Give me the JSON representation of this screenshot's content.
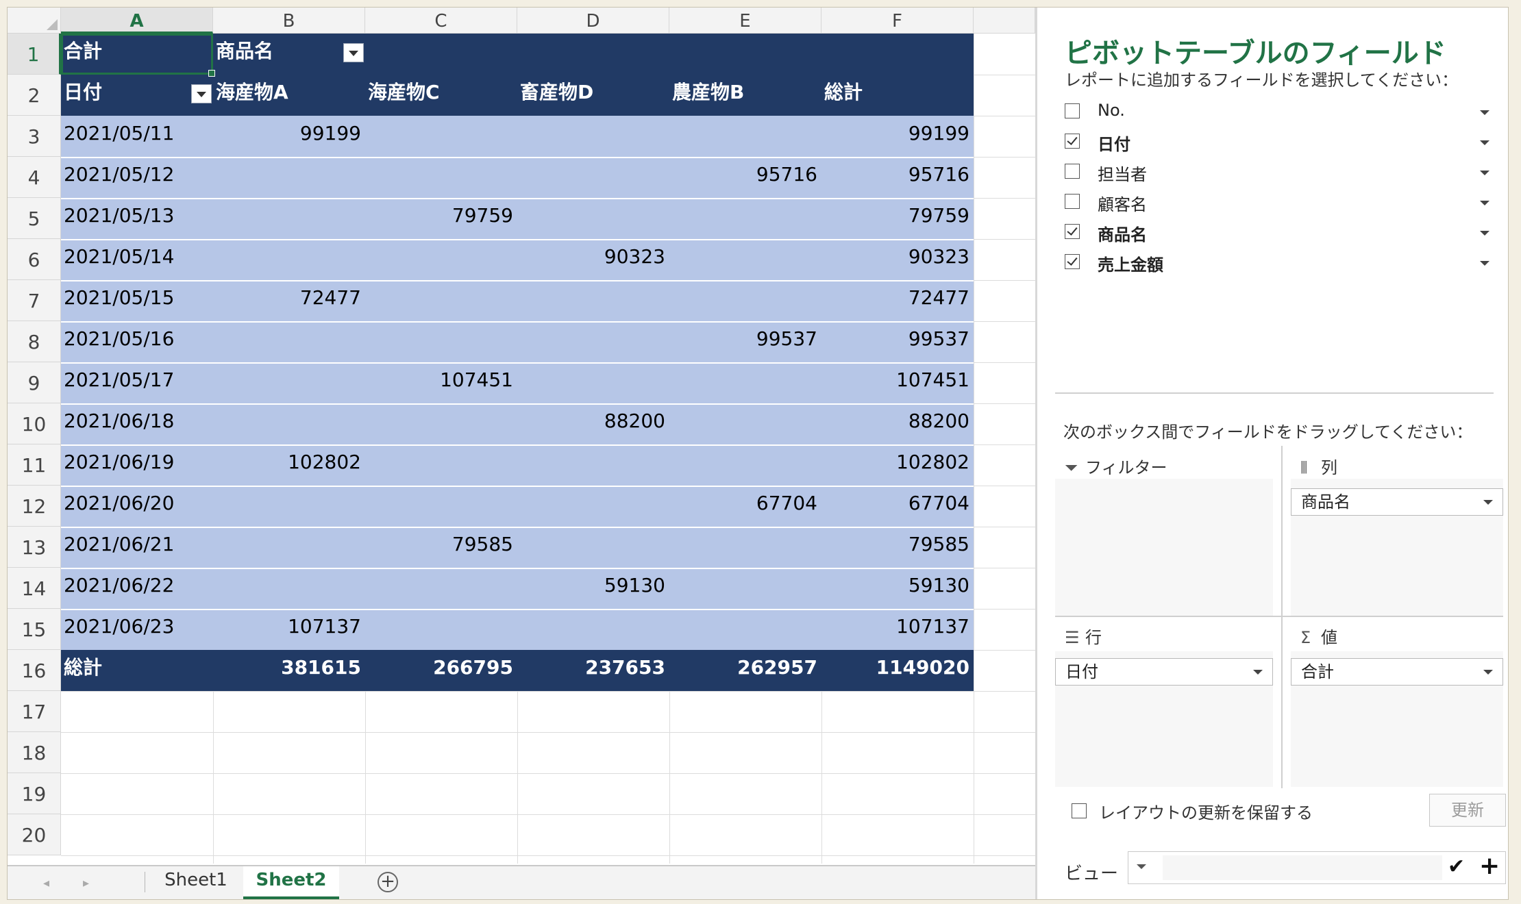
{
  "columns": [
    "A",
    "B",
    "C",
    "D",
    "E",
    "F"
  ],
  "rows": [
    "1",
    "2",
    "3",
    "4",
    "5",
    "6",
    "7",
    "8",
    "9",
    "10",
    "11",
    "12",
    "13",
    "14",
    "15",
    "16",
    "17",
    "18",
    "19",
    "20"
  ],
  "pivot": {
    "value_label": "合計",
    "col_field_label": "商品名",
    "row_field_label": "日付",
    "col_headers": [
      "海産物A",
      "海産物C",
      "畜産物D",
      "農産物B",
      "総計"
    ],
    "rows": [
      {
        "date": "2021/05/11",
        "vals": [
          "99199",
          "",
          "",
          "",
          "99199"
        ]
      },
      {
        "date": "2021/05/12",
        "vals": [
          "",
          "",
          "",
          "95716",
          "95716"
        ]
      },
      {
        "date": "2021/05/13",
        "vals": [
          "",
          "79759",
          "",
          "",
          "79759"
        ]
      },
      {
        "date": "2021/05/14",
        "vals": [
          "",
          "",
          "90323",
          "",
          "90323"
        ]
      },
      {
        "date": "2021/05/15",
        "vals": [
          "72477",
          "",
          "",
          "",
          "72477"
        ]
      },
      {
        "date": "2021/05/16",
        "vals": [
          "",
          "",
          "",
          "99537",
          "99537"
        ]
      },
      {
        "date": "2021/05/17",
        "vals": [
          "",
          "107451",
          "",
          "",
          "107451"
        ]
      },
      {
        "date": "2021/06/18",
        "vals": [
          "",
          "",
          "88200",
          "",
          "88200"
        ]
      },
      {
        "date": "2021/06/19",
        "vals": [
          "102802",
          "",
          "",
          "",
          "102802"
        ]
      },
      {
        "date": "2021/06/20",
        "vals": [
          "",
          "",
          "",
          "67704",
          "67704"
        ]
      },
      {
        "date": "2021/06/21",
        "vals": [
          "",
          "79585",
          "",
          "",
          "79585"
        ]
      },
      {
        "date": "2021/06/22",
        "vals": [
          "",
          "",
          "59130",
          "",
          "59130"
        ]
      },
      {
        "date": "2021/06/23",
        "vals": [
          "107137",
          "",
          "",
          "",
          "107137"
        ]
      }
    ],
    "total_label": "総計",
    "totals": [
      "381615",
      "266795",
      "237653",
      "262957",
      "1149020"
    ]
  },
  "tabs": {
    "sheets": [
      "Sheet1",
      "Sheet2"
    ],
    "active": "Sheet2"
  },
  "pane": {
    "title": "ピボットテーブルのフィールド",
    "subtitle": "レポートに追加するフィールドを選択してください：",
    "fields": [
      {
        "label": "No.",
        "checked": false
      },
      {
        "label": "日付",
        "checked": true
      },
      {
        "label": "担当者",
        "checked": false
      },
      {
        "label": "顧客名",
        "checked": false
      },
      {
        "label": "商品名",
        "checked": true
      },
      {
        "label": "売上金額",
        "checked": true
      }
    ],
    "drag_hint": "次のボックス間でフィールドをドラッグしてください：",
    "areas": {
      "filter": {
        "label": "フィルター"
      },
      "columns": {
        "label": "列",
        "item": "商品名"
      },
      "rows": {
        "label": "行",
        "item": "日付"
      },
      "values": {
        "label": "値",
        "item": "合計"
      }
    },
    "defer_label": "レイアウトの更新を保留する",
    "update_label": "更新",
    "view_label": "ビュー"
  },
  "colors": {
    "accent": "#217346",
    "pivot_dark": "#213a65",
    "pivot_light": "#b6c6e7"
  },
  "icons": [
    "filter-icon",
    "columns-icon",
    "rows-icon",
    "sigma-icon",
    "checkmark-icon",
    "plus-icon",
    "add-sheet-icon"
  ]
}
